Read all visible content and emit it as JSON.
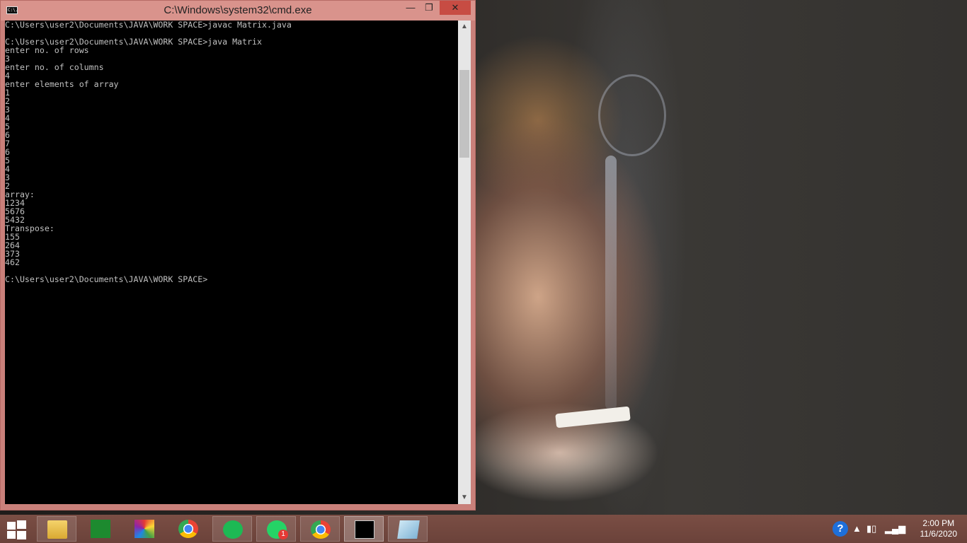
{
  "window": {
    "title": "C:\\Windows\\system32\\cmd.exe",
    "icon_text": "C:\\.",
    "minimize_glyph": "—",
    "maximize_glyph": "❐",
    "close_glyph": "✕"
  },
  "console": {
    "lines": [
      "C:\\Users\\user2\\Documents\\JAVA\\WORK SPACE>javac Matrix.java",
      "",
      "C:\\Users\\user2\\Documents\\JAVA\\WORK SPACE>java Matrix",
      "enter no. of rows",
      "3",
      "enter no. of columns",
      "4",
      "enter elements of array",
      "1",
      "2",
      "3",
      "4",
      "5",
      "6",
      "7",
      "6",
      "5",
      "4",
      "3",
      "2",
      "array:",
      "1234",
      "5676",
      "5432",
      "Transpose:",
      "155",
      "264",
      "373",
      "462",
      "",
      "C:\\Users\\user2\\Documents\\JAVA\\WORK SPACE>"
    ]
  },
  "taskbar": {
    "apps": [
      {
        "name": "file-explorer",
        "icon": "folder-icon"
      },
      {
        "name": "store",
        "icon": "store-icon"
      },
      {
        "name": "games",
        "icon": "games-icon"
      },
      {
        "name": "chrome",
        "icon": "chrome-icon"
      },
      {
        "name": "spotify",
        "icon": "spotify-icon"
      },
      {
        "name": "whatsapp",
        "icon": "whatsapp-icon",
        "badge": "1"
      },
      {
        "name": "chrome-profile",
        "icon": "chrome-profile-icon"
      },
      {
        "name": "command-prompt",
        "icon": "cmd-icon"
      },
      {
        "name": "notepad",
        "icon": "notepad-icon"
      }
    ],
    "clock": {
      "time": "2:00 PM",
      "date": "11/6/2020"
    },
    "accent": "#6b423a"
  }
}
